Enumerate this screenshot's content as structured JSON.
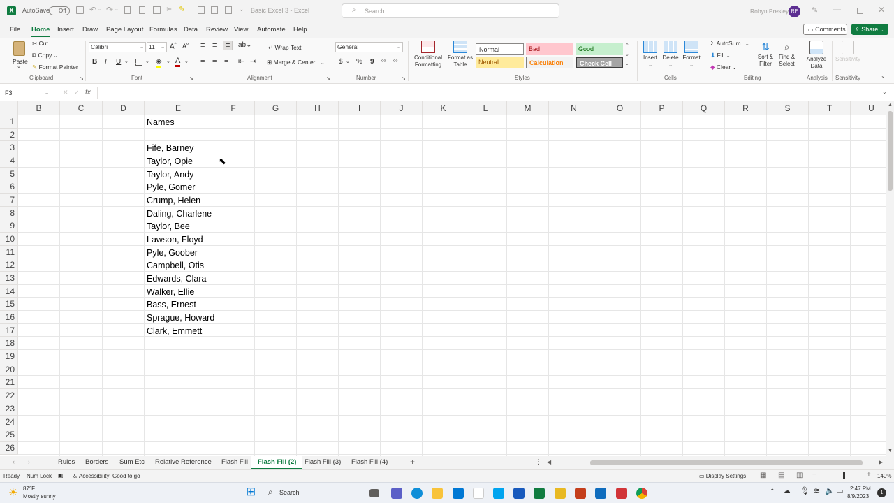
{
  "titlebar": {
    "autosave_label": "AutoSave",
    "autosave_state": "Off",
    "doc_title": "Basic Excel 3 - Excel",
    "search_placeholder": "Search",
    "user_name": "Robyn Presley",
    "user_initials": "RP"
  },
  "menu": {
    "items": [
      "File",
      "Home",
      "Insert",
      "Draw",
      "Page Layout",
      "Formulas",
      "Data",
      "Review",
      "View",
      "Automate",
      "Help"
    ],
    "comments": "Comments",
    "share": "Share"
  },
  "ribbon": {
    "clipboard": {
      "paste": "Paste",
      "cut": "Cut",
      "copy": "Copy",
      "format_painter": "Format Painter",
      "label": "Clipboard"
    },
    "font": {
      "name": "Calibri",
      "size": "11",
      "bold": "B",
      "italic": "I",
      "underline": "U",
      "label": "Font"
    },
    "alignment": {
      "wrap": "Wrap Text",
      "merge": "Merge & Center",
      "label": "Alignment"
    },
    "number": {
      "format": "General",
      "currency": "$",
      "percent": "%",
      "comma": "9",
      "label": "Number"
    },
    "styles": {
      "cond": "Conditional Formatting",
      "table": "Format as Table",
      "normal": "Normal",
      "bad": "Bad",
      "good": "Good",
      "neutral": "Neutral",
      "calculation": "Calculation",
      "check": "Check Cell",
      "label": "Styles"
    },
    "cells": {
      "insert": "Insert",
      "delete": "Delete",
      "format": "Format",
      "label": "Cells"
    },
    "editing": {
      "autosum": "AutoSum",
      "fill": "Fill",
      "clear": "Clear",
      "sort": "Sort & Filter",
      "find": "Find & Select",
      "label": "Editing"
    },
    "analysis": {
      "analyze": "Analyze Data",
      "label": "Analysis"
    },
    "sensitivity": {
      "button": "Sensitivity",
      "label": "Sensitivity"
    }
  },
  "formula_bar": {
    "name_box": "F3",
    "fx": "fx",
    "value": ""
  },
  "grid": {
    "columns": [
      "B",
      "C",
      "D",
      "E",
      "F",
      "G",
      "H",
      "I",
      "J",
      "K",
      "L",
      "M",
      "N",
      "O",
      "P",
      "Q",
      "R",
      "S",
      "T",
      "U"
    ],
    "rows": [
      "1",
      "2",
      "3",
      "4",
      "5",
      "6",
      "7",
      "8",
      "9",
      "10",
      "11",
      "12",
      "13",
      "14",
      "15",
      "16",
      "17",
      "18",
      "19",
      "20",
      "21",
      "22",
      "23",
      "24",
      "25",
      "26"
    ],
    "header": "Names",
    "names": [
      "Fife, Barney",
      "Taylor, Opie",
      "Taylor, Andy",
      "Pyle, Gomer",
      "Crump, Helen",
      "Daling, Charlene",
      "Taylor, Bee",
      "Lawson, Floyd",
      "Pyle, Goober",
      "Campbell, Otis",
      "Edwards, Clara",
      "Walker, Ellie",
      "Bass, Ernest",
      "Sprague, Howard",
      "Clark, Emmett"
    ]
  },
  "sheets": {
    "tabs": [
      "Rules",
      "Borders",
      "Sum Etc",
      "Relative Reference",
      "Flash Fill",
      "Flash Fill (2)",
      "Flash Fill (3)",
      "Flash Fill (4)"
    ],
    "active": "Flash Fill (2)"
  },
  "status": {
    "ready": "Ready",
    "numlock": "Num Lock",
    "accessibility": "Accessibility: Good to go",
    "display_settings": "Display Settings",
    "zoom": "140%"
  },
  "taskbar": {
    "weather_temp": "87°F",
    "weather_desc": "Mostly sunny",
    "search": "Search",
    "time": "2:47 PM",
    "date": "8/9/2023"
  },
  "colors": {
    "excel_green": "#107c41",
    "ribbon_bg": "#f9f9f9",
    "bad_bg": "#ffc7ce",
    "good_bg": "#c6efce",
    "neutral_bg": "#ffeb9c",
    "calc_bg": "#f2f2f2",
    "check_bg": "#a5a5a5"
  }
}
